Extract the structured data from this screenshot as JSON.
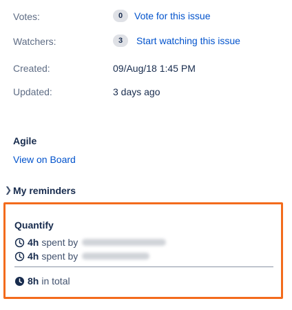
{
  "details": {
    "votes": {
      "label": "Votes:",
      "count": "0",
      "action": "Vote for this issue"
    },
    "watchers": {
      "label": "Watchers:",
      "count": "3",
      "action": "Start watching this issue"
    },
    "created": {
      "label": "Created:",
      "value": "09/Aug/18 1:45 PM"
    },
    "updated": {
      "label": "Updated:",
      "value": "3 days ago"
    }
  },
  "agile": {
    "heading": "Agile",
    "link": "View on Board"
  },
  "reminders": {
    "heading": "My reminders"
  },
  "quantify": {
    "heading": "Quantify",
    "entries": [
      {
        "amount": "4h",
        "text": "spent by"
      },
      {
        "amount": "4h",
        "text": "spent by"
      }
    ],
    "total": {
      "amount": "8h",
      "text": "in total"
    }
  },
  "colors": {
    "link": "#0052cc",
    "highlight_border": "#f36b1c"
  }
}
